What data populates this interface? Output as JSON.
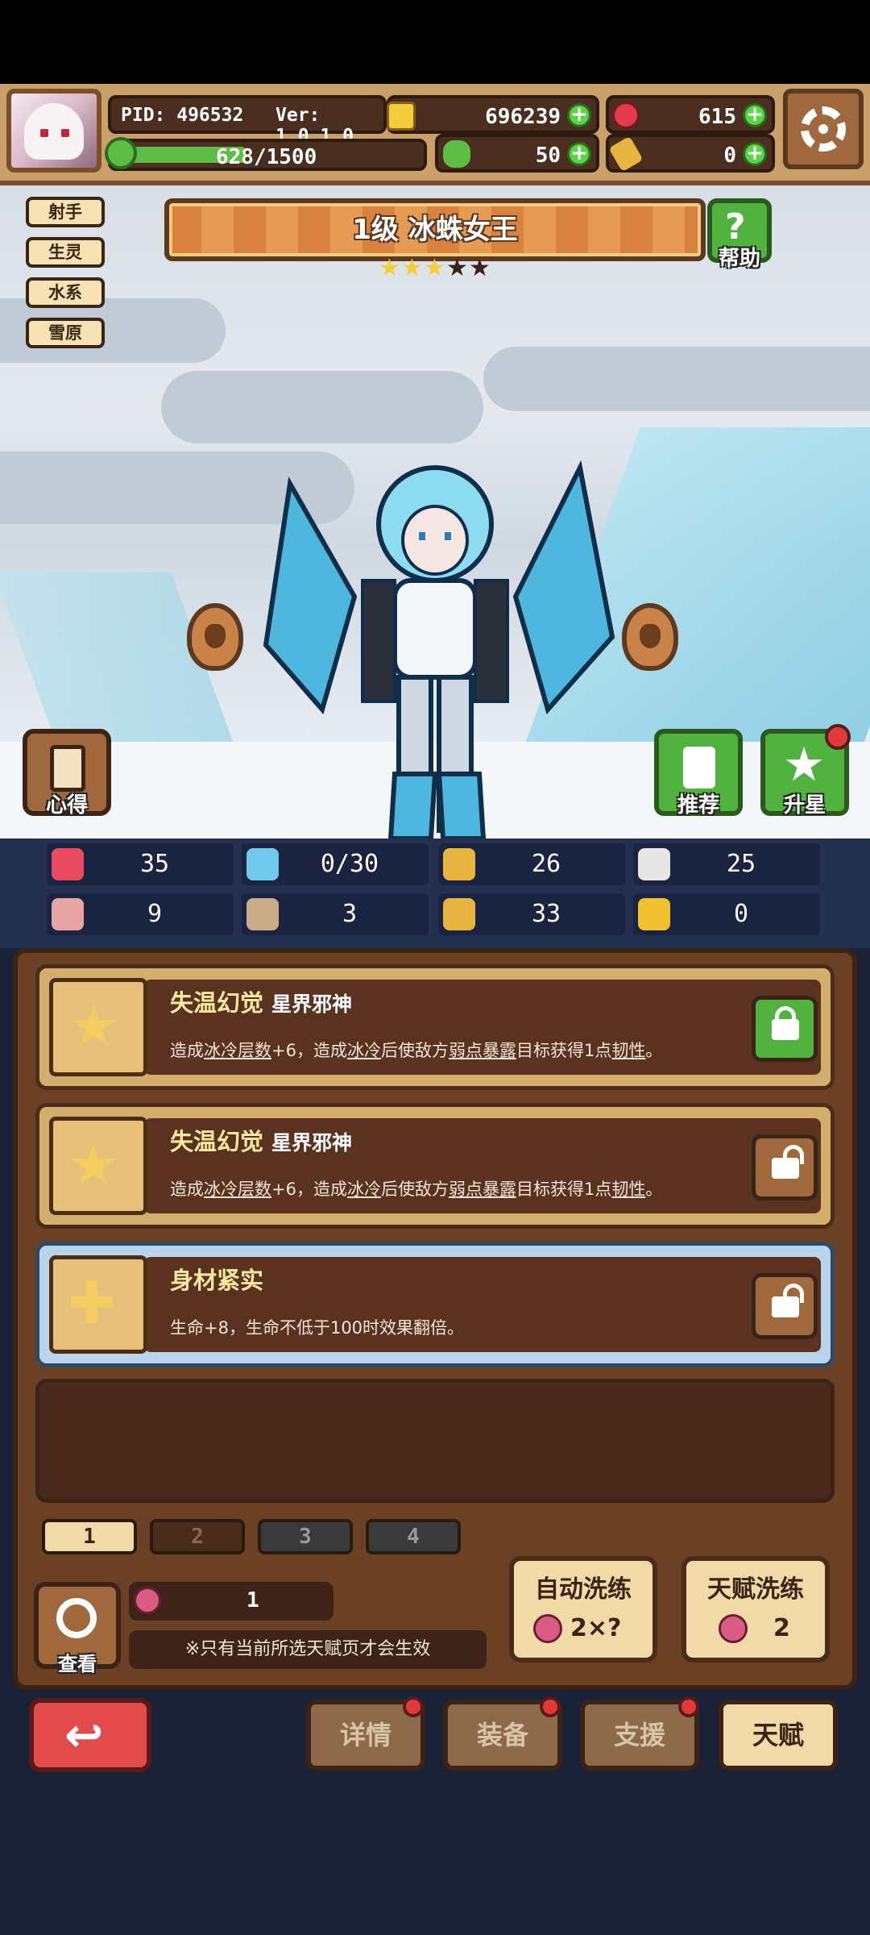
{
  "header": {
    "pid": "PID: 496532",
    "version": "Ver: 1.0.1.0",
    "gold": "696239",
    "gems": "615",
    "clover": "50",
    "keys": "0",
    "xp": "628/1500",
    "xp_fraction": 0.42
  },
  "tags": [
    "射手",
    "生灵",
    "水系",
    "雪原"
  ],
  "hero": {
    "title": "1级 冰蛛女王",
    "stars_filled": 3,
    "stars_total": 5,
    "help_label": "帮助",
    "notes_label": "心得",
    "recommend_label": "推荐",
    "upgrade_label": "升星"
  },
  "stats": [
    {
      "icon": "heart-icon",
      "value": "35",
      "color": "#e84a5f"
    },
    {
      "icon": "water-drop-icon",
      "value": "0/30",
      "color": "#6ec9ec"
    },
    {
      "icon": "shield-icon",
      "value": "26",
      "color": "#e8b640"
    },
    {
      "icon": "wing-icon",
      "value": "25",
      "color": "#e6e6e6"
    },
    {
      "icon": "fist-icon",
      "value": "9",
      "color": "#e9a5a5"
    },
    {
      "icon": "book-icon",
      "value": "3",
      "color": "#c9ad88"
    },
    {
      "icon": "boot-icon",
      "value": "33",
      "color": "#e8b640"
    },
    {
      "icon": "horseshoe-icon",
      "value": "0",
      "color": "#f0c030"
    }
  ],
  "talents": [
    {
      "name": "失温幻觉",
      "sub": "星界邪神",
      "desc_parts": [
        "造成",
        "冰冷层数",
        "+6，造成",
        "冰冷",
        "后使敌方",
        "弱点暴露",
        "目标获得1点",
        "韧性",
        "。"
      ],
      "locked": true
    },
    {
      "name": "失温幻觉",
      "sub": "星界邪神",
      "desc_parts": [
        "造成",
        "冰冷层数",
        "+6，造成",
        "冰冷",
        "后使敌方",
        "弱点暴露",
        "目标获得1点",
        "韧性",
        "。"
      ],
      "locked": false
    },
    {
      "name": "身材紧实",
      "sub": "",
      "desc_parts": [
        "生命+8，生命不低于100时效果翻倍。"
      ],
      "locked": false
    }
  ],
  "pages": [
    "1",
    "2",
    "3",
    "4"
  ],
  "bottom": {
    "view_label": "查看",
    "fruit_count": "1",
    "note": "※只有当前所选天赋页才会生效",
    "auto_refine_label": "自动洗练",
    "auto_refine_cost": "2×?",
    "talent_refine_label": "天赋洗练",
    "talent_refine_cost": "2"
  },
  "nav": {
    "details": "详情",
    "equipment": "装备",
    "support": "支援",
    "talent": "天赋"
  }
}
